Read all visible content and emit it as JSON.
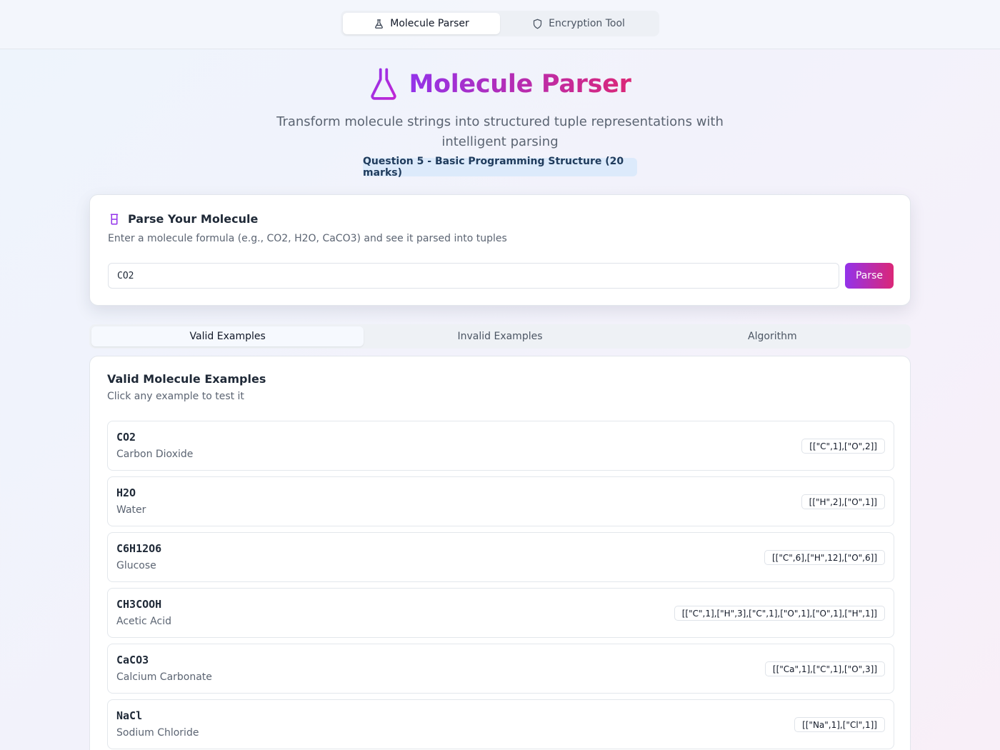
{
  "nav": {
    "tabs": [
      {
        "label": "Molecule Parser",
        "icon": "flask-icon",
        "active": true
      },
      {
        "label": "Encryption Tool",
        "icon": "shield-icon",
        "active": false
      }
    ]
  },
  "hero": {
    "title": "Molecule Parser",
    "subtitle": "Transform molecule strings into structured tuple representations with intelligent parsing",
    "badge": "Question 5 - Basic Programming Structure (20 marks)"
  },
  "parse": {
    "title": "Parse Your Molecule",
    "description": "Enter a molecule formula (e.g., CO2, H2O, CaCO3) and see it parsed into tuples",
    "input_value": "CO2",
    "button_label": "Parse"
  },
  "section_tabs": [
    {
      "label": "Valid Examples",
      "active": true
    },
    {
      "label": "Invalid Examples",
      "active": false
    },
    {
      "label": "Algorithm",
      "active": false
    }
  ],
  "examples": {
    "title": "Valid Molecule Examples",
    "subtitle": "Click any example to test it",
    "items": [
      {
        "formula": "CO2",
        "name": "Carbon Dioxide",
        "tuple": "[[\"C\",1],[\"O\",2]]"
      },
      {
        "formula": "H2O",
        "name": "Water",
        "tuple": "[[\"H\",2],[\"O\",1]]"
      },
      {
        "formula": "C6H12O6",
        "name": "Glucose",
        "tuple": "[[\"C\",6],[\"H\",12],[\"O\",6]]"
      },
      {
        "formula": "CH3COOH",
        "name": "Acetic Acid",
        "tuple": "[[\"C\",1],[\"H\",3],[\"C\",1],[\"O\",1],[\"O\",1],[\"H\",1]]"
      },
      {
        "formula": "CaCO3",
        "name": "Calcium Carbonate",
        "tuple": "[[\"Ca\",1],[\"C\",1],[\"O\",3]]"
      },
      {
        "formula": "NaCl",
        "name": "Sodium Chloride",
        "tuple": "[[\"Na\",1],[\"Cl\",1]]"
      }
    ]
  },
  "colors": {
    "accent_start": "#9333ea",
    "accent_end": "#db2777",
    "badge_bg": "#dceafb"
  }
}
